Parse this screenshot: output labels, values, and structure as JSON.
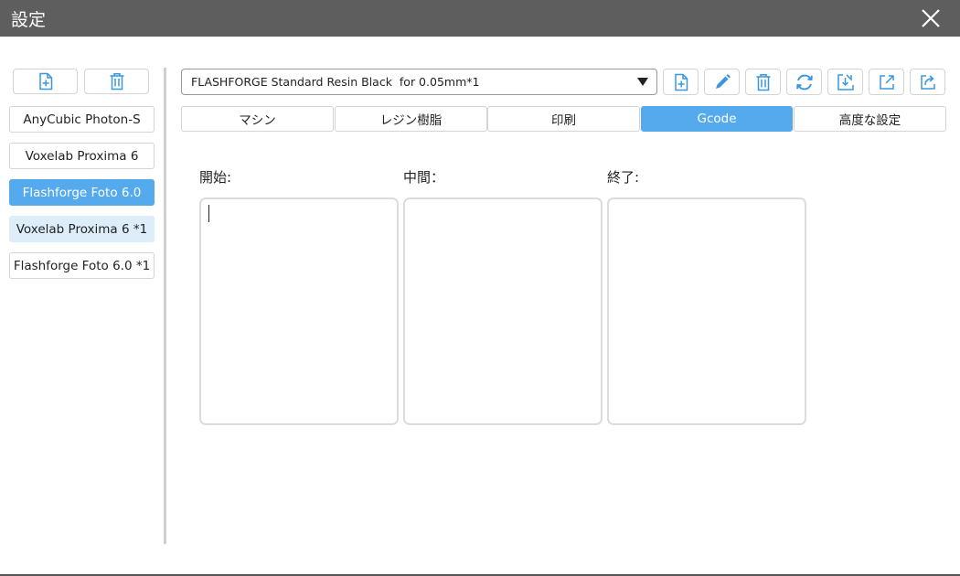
{
  "window": {
    "title": "設定",
    "close_icon": "close-icon"
  },
  "sidebar": {
    "add_icon": "add-file-icon",
    "delete_icon": "trash-icon",
    "printers": [
      {
        "label": "AnyCubic Photon-S",
        "state": "normal"
      },
      {
        "label": "Voxelab Proxima 6",
        "state": "normal"
      },
      {
        "label": "Flashforge Foto 6.0",
        "state": "selected"
      },
      {
        "label": "Voxelab Proxima 6 *1",
        "state": "hover"
      },
      {
        "label": "Flashforge Foto 6.0 *1",
        "state": "normal"
      }
    ]
  },
  "profile": {
    "selected": "FLASHFORGE Standard Resin Black  for 0.05mm*1"
  },
  "toolbar": {
    "icons": [
      "add-file-icon",
      "edit-icon",
      "trash-icon",
      "refresh-icon",
      "import-icon",
      "export-icon",
      "share-icon"
    ]
  },
  "tabs": [
    {
      "label": "マシン",
      "active": false
    },
    {
      "label": "レジン樹脂",
      "active": false
    },
    {
      "label": "印刷",
      "active": false
    },
    {
      "label": "Gcode",
      "active": true
    },
    {
      "label": "高度な設定",
      "active": false
    }
  ],
  "gcode": {
    "start_label": "開始:",
    "middle_label": "中間：",
    "end_label": "終了:",
    "start_value": "",
    "middle_value": "",
    "end_value": ""
  },
  "colors": {
    "accent": "#55aaee",
    "icon": "#3a96dd",
    "titlebar": "#5e5e5e"
  }
}
